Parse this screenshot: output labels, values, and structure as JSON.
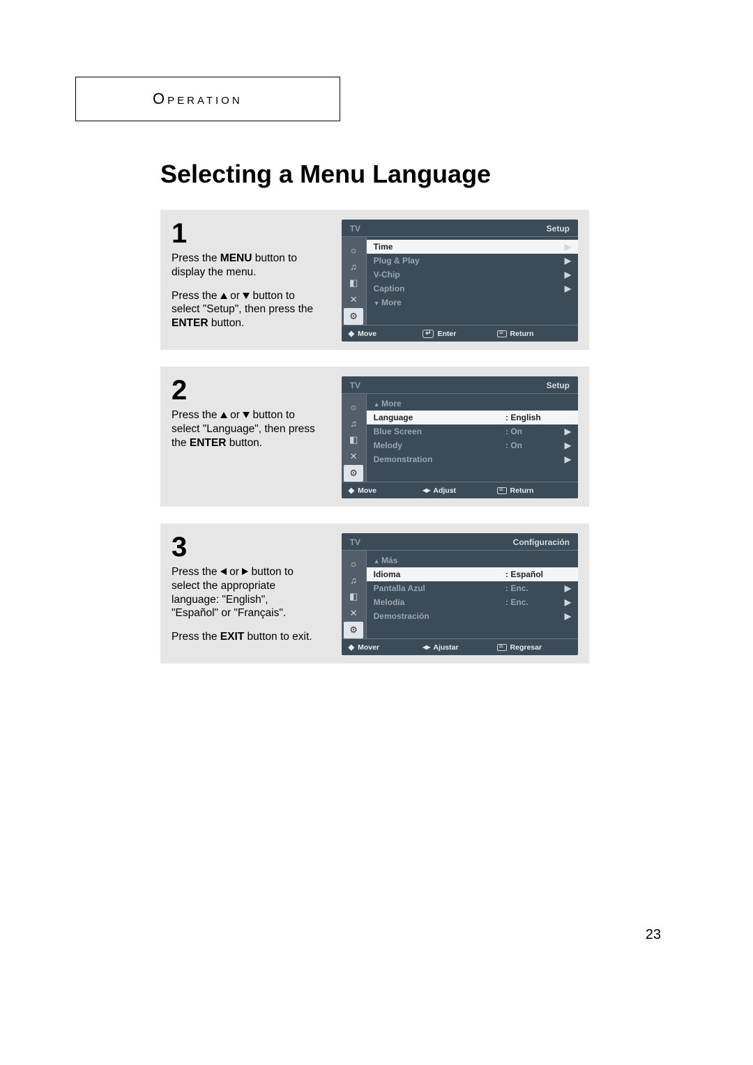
{
  "section_label": "Operation",
  "page_title": "Selecting a Menu Language",
  "page_number": "23",
  "steps": {
    "s1": {
      "num": "1",
      "p1a": "Press the ",
      "p1b": "MENU",
      "p1c": " button to display the menu.",
      "p2a": "Press the ",
      "p2b": " or ",
      "p2c": " button to select \"Setup\", then press the ",
      "p2d": "ENTER",
      "p2e": " button."
    },
    "s2": {
      "num": "2",
      "p1a": "Press the ",
      "p1b": " or ",
      "p1c": " button to select \"Language\", then press the ",
      "p1d": "ENTER",
      "p1e": " button."
    },
    "s3": {
      "num": "3",
      "p1a": "Press the ",
      "p1b": " or ",
      "p1c": " button to select the appropriate language: \"English\", \"Español\" or \"Français\".",
      "p2a": "Press the ",
      "p2b": "EXIT",
      "p2c": " button to exit."
    }
  },
  "osd1": {
    "tv": "TV",
    "title": "Setup",
    "rows": {
      "time": "Time",
      "plugplay": "Plug & Play",
      "vchip": "V-Chip",
      "caption": "Caption",
      "more": "More"
    },
    "foot": {
      "move": "Move",
      "enter": "Enter",
      "return": "Return"
    }
  },
  "osd2": {
    "tv": "TV",
    "title": "Setup",
    "rows": {
      "more": "More",
      "language": "Language",
      "language_val": ": English",
      "bluescreen": "Blue Screen",
      "bluescreen_val": ": On",
      "melody": "Melody",
      "melody_val": ": On",
      "demo": "Demonstration"
    },
    "foot": {
      "move": "Move",
      "adjust": "Adjust",
      "return": "Return"
    }
  },
  "osd3": {
    "tv": "TV",
    "title": "Configuración",
    "rows": {
      "mas": "Más",
      "idioma": "Idioma",
      "idioma_val": ": Español",
      "pantalla": "Pantalla Azul",
      "pantalla_val": ": Enc.",
      "melodia": "Melodía",
      "melodia_val": ": Enc.",
      "demo": "Demostración"
    },
    "foot": {
      "mover": "Mover",
      "ajustar": "Ajustar",
      "regresar": "Regresar"
    }
  }
}
